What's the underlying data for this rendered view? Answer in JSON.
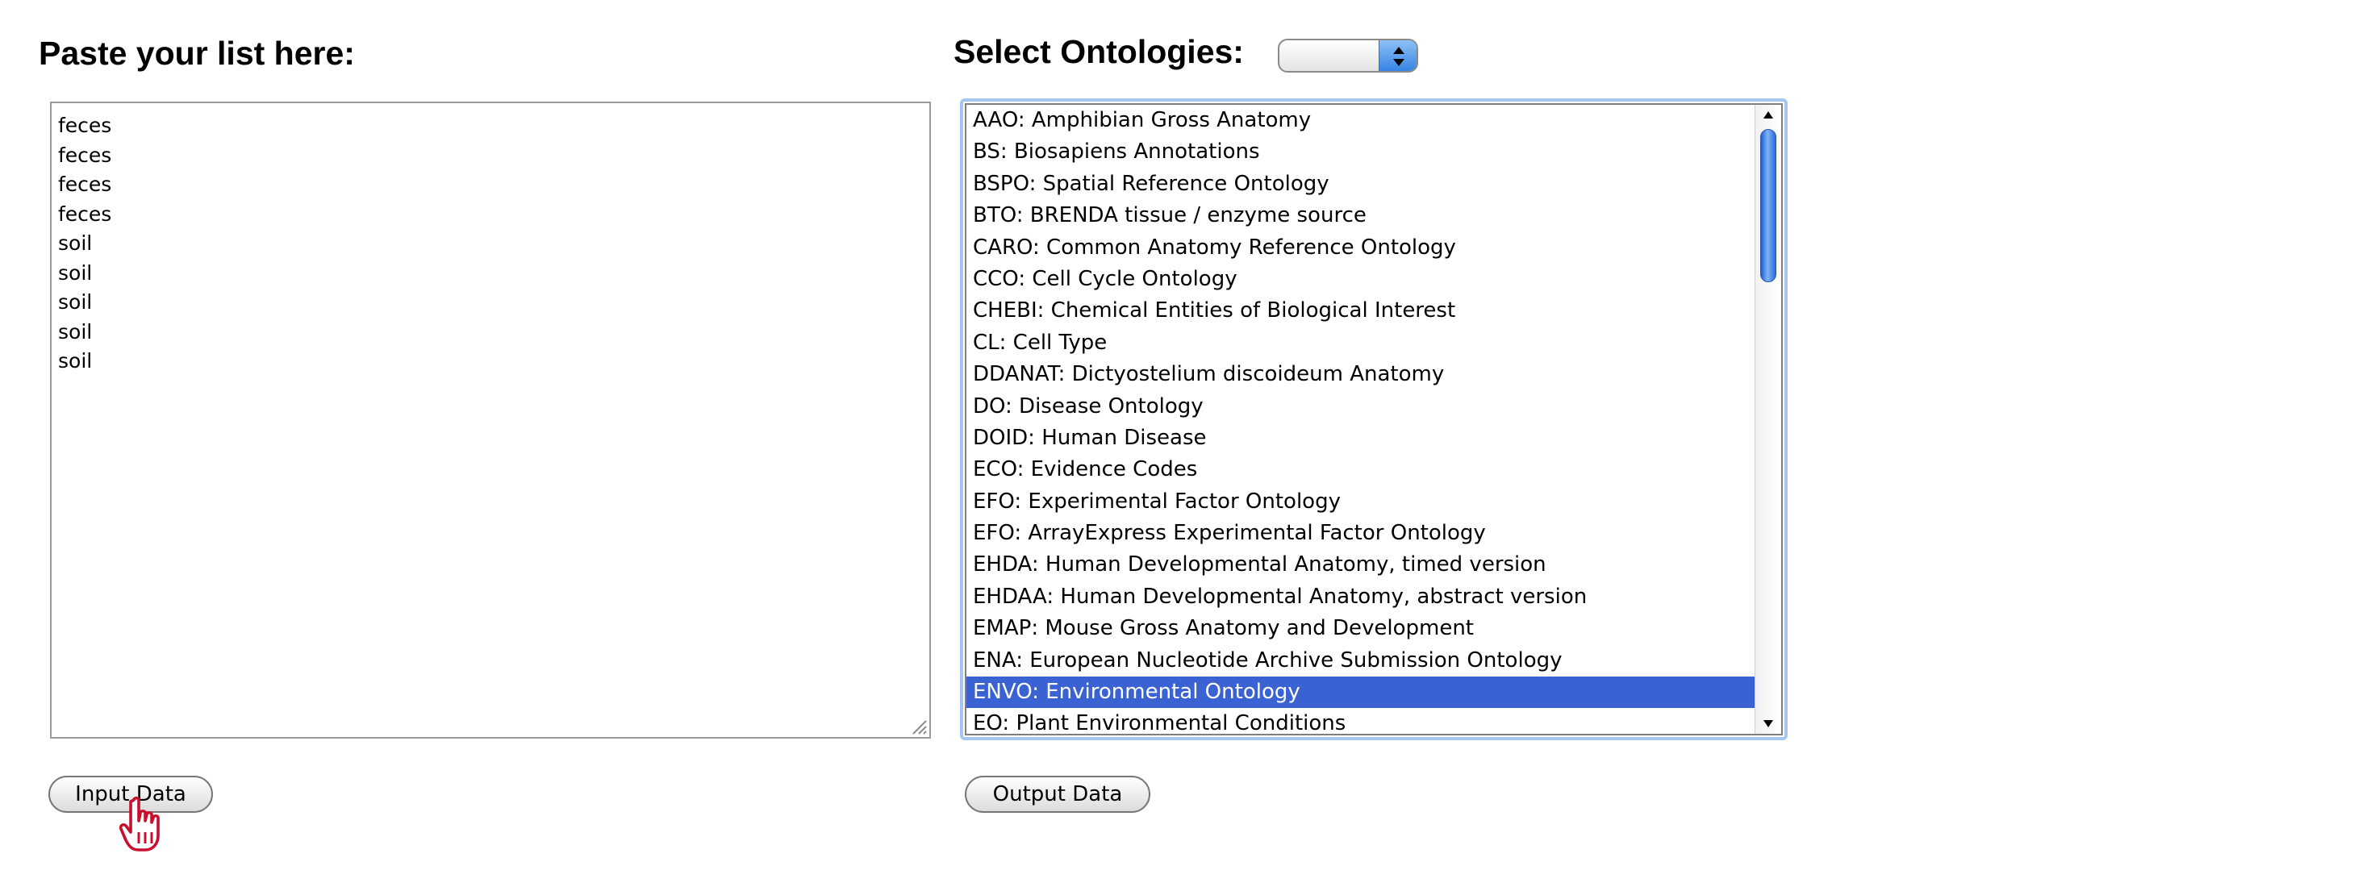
{
  "left_panel": {
    "heading": "Paste your list here:",
    "textarea_lines": [
      "feces",
      "feces",
      "feces",
      "feces",
      "soil",
      "soil",
      "soil",
      "soil",
      "soil"
    ],
    "input_button_label": "Input Data"
  },
  "right_panel": {
    "heading": "Select Ontologies:",
    "popup_select_value": "",
    "options": [
      "AAO: Amphibian Gross Anatomy",
      "BS: Biosapiens Annotations",
      "BSPO: Spatial Reference Ontology",
      "BTO: BRENDA tissue / enzyme source",
      "CARO: Common Anatomy Reference Ontology",
      "CCO: Cell Cycle Ontology",
      "CHEBI: Chemical Entities of Biological Interest",
      "CL: Cell Type",
      "DDANAT: Dictyostelium discoideum Anatomy",
      "DO: Disease Ontology",
      "DOID: Human Disease",
      "ECO: Evidence Codes",
      "EFO: Experimental Factor Ontology",
      "EFO: ArrayExpress Experimental Factor Ontology",
      "EHDA: Human Developmental Anatomy, timed version",
      "EHDAA: Human Developmental Anatomy, abstract version",
      "EMAP: Mouse Gross Anatomy and Development",
      "ENA: European Nucleotide Archive Submission Ontology",
      "ENVO: Environmental Ontology",
      "EO: Plant Environmental Conditions"
    ],
    "selected_option": "ENVO: Environmental Ontology",
    "output_button_label": "Output Data"
  },
  "colors": {
    "selection": "#3a62d2",
    "focus_ring": "#a7c6ef",
    "cursor": "#c8102e"
  },
  "icons": {
    "cursor": "hand-pointer-icon",
    "popup_arrows": "up-down-arrows-icon",
    "resize_grip": "resize-grip-icon"
  }
}
